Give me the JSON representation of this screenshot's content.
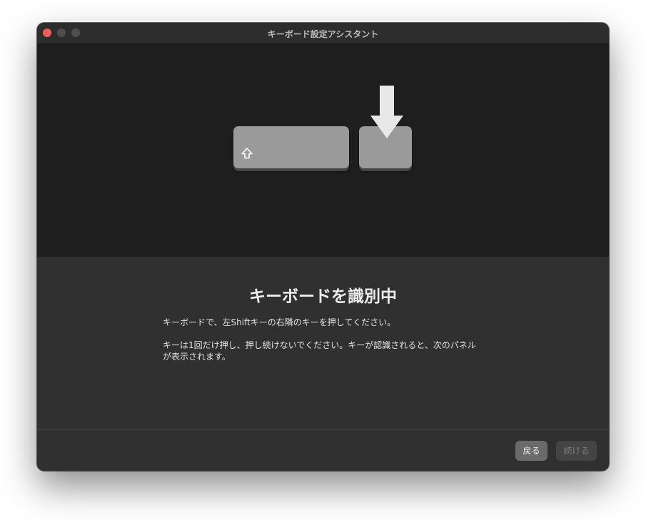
{
  "window": {
    "title": "キーボード設定アシスタント"
  },
  "illustration": {
    "modifier_key_icon": "shift-icon",
    "pointer_icon": "down-arrow-icon"
  },
  "main": {
    "heading": "キーボードを識別中",
    "instruction": "キーボードで、左Shiftキーの右隣のキーを押してください。",
    "note": "キーは1回だけ押し、押し続けないでください。キーが認識されると、次のパネルが表示されます。"
  },
  "footer": {
    "back_label": "戻る",
    "continue_label": "続ける"
  },
  "colors": {
    "close_button": "#ec5f57",
    "illustration_background": "#1e1e1e",
    "content_background": "#303030",
    "key_face": "#9a9a9a",
    "arrow": "#e8e8e8"
  }
}
